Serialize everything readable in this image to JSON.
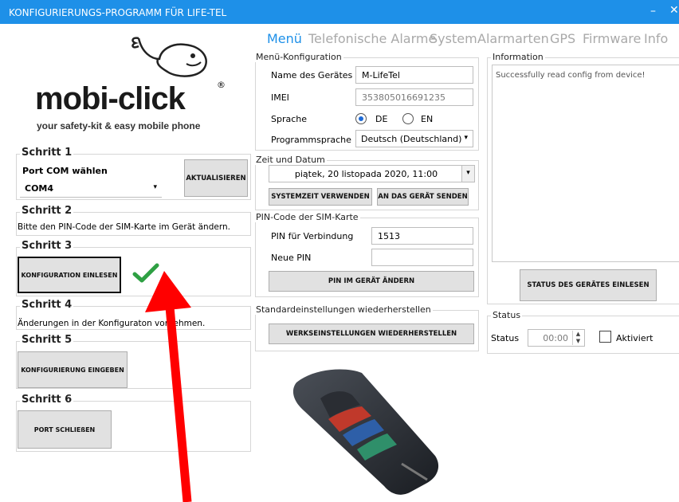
{
  "window": {
    "title": "KONFIGURIERUNGS-PROGRAMM FÜR LIFE-TEL",
    "minimize": "–",
    "close": "✕"
  },
  "logo": {
    "brand": "mobi-click",
    "registered": "®",
    "tagline": "your safety-kit & easy mobile phone"
  },
  "tabs": [
    "Menü",
    "Telefonische Alarme",
    "System",
    "Alarmarten",
    "GPS",
    "Firmware",
    "Info"
  ],
  "steps": {
    "s1": {
      "title": "Schritt 1",
      "port_label": "Port COM wählen",
      "port_value": "COM4",
      "refresh_button": "AKTUALISIEREN"
    },
    "s2": {
      "title": "Schritt 2",
      "text": "Bitte den PIN-Code der SIM-Karte im Gerät ändern."
    },
    "s3": {
      "title": "Schritt 3",
      "button": "KONFIGURATION EINLESEN"
    },
    "s4": {
      "title": "Schritt 4",
      "text": "Änderungen in der Konfiguraton vornehmen."
    },
    "s5": {
      "title": "Schritt 5",
      "button": "KONFIGURIERUNG EINGEBEN"
    },
    "s6": {
      "title": "Schritt 6",
      "button": "PORT SCHLIEßEN"
    }
  },
  "menu_config": {
    "title": "Menü-Konfiguration",
    "device_name_label": "Name des Gerätes",
    "device_name_value": "M-LifeTel",
    "imei_label": "IMEI",
    "imei_value": "353805016691235",
    "language_label": "Sprache",
    "lang_de": "DE",
    "lang_en": "EN",
    "lang_selected": "DE",
    "program_language_label": "Programmsprache",
    "program_language_value": "Deutsch (Deutschland)"
  },
  "datetime": {
    "title": "Zeit und Datum",
    "value": "piątek, 20 listopada 2020, 11:00",
    "use_system_button": "SYSTEMZEIT VERWENDEN",
    "send_button": "AN DAS GERÄT SENDEN"
  },
  "pin": {
    "title": "PIN-Code der SIM-Karte",
    "connect_label": "PIN für Verbindung",
    "connect_value": "1513",
    "new_label": "Neue PIN",
    "new_value": "",
    "change_button": "PIN IM GERÄT ÄNDERN"
  },
  "defaults": {
    "title": "Standardeinstellungen wiederherstellen",
    "button": "WERKSEINSTELLUNGEN WIEDERHERSTELLEN"
  },
  "information": {
    "title": "Information",
    "text": "Successfully read config from device!",
    "status_button": "STATUS DES GERÄTES EINLESEN"
  },
  "status": {
    "title": "Status",
    "label": "Status",
    "time_value": "00:00",
    "activated_label": "Aktiviert",
    "activated": false
  },
  "colors": {
    "accent": "#1e90e8",
    "check": "#2ea043",
    "arrow": "#ff0000"
  },
  "icons": [
    "check-icon",
    "red-arrow-annotation",
    "device-image",
    "whale-logo-icon"
  ]
}
